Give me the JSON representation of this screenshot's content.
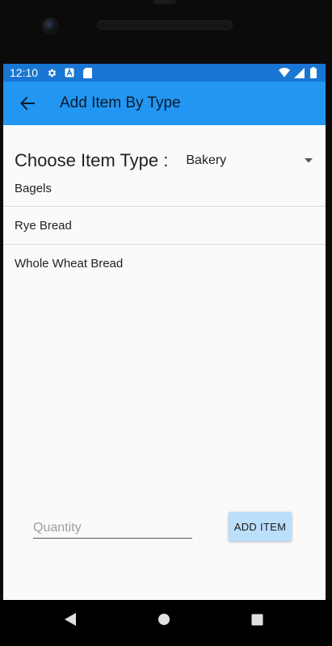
{
  "status_bar": {
    "time": "12:10",
    "icons_left": [
      "gear-icon",
      "a-letter-icon",
      "sd-card-icon"
    ],
    "icons_right": [
      "wifi-icon",
      "signal-icon",
      "battery-icon"
    ]
  },
  "app_bar": {
    "back_icon": "arrow-left-icon",
    "title": "Add Item By Type"
  },
  "chooser": {
    "label": "Choose Item Type :",
    "selected": "Bakery"
  },
  "items": [
    {
      "label": "Bagels"
    },
    {
      "label": "Rye Bread"
    },
    {
      "label": "Whole Wheat Bread"
    }
  ],
  "form": {
    "quantity_placeholder": "Quantity",
    "quantity_value": "",
    "add_button_label": "ADD ITEM"
  },
  "nav": {
    "icons": [
      "triangle-back-icon",
      "circle-home-icon",
      "square-recents-icon"
    ]
  },
  "colors": {
    "status_bar": "#1976d2",
    "app_bar": "#2196f3",
    "button": "#bbdefb"
  }
}
